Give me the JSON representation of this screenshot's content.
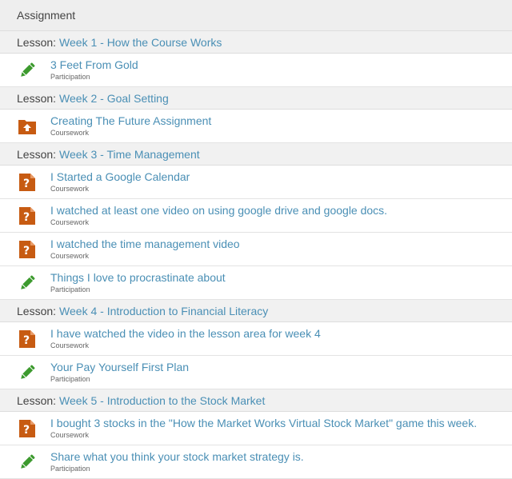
{
  "header": {
    "title": "Assignment"
  },
  "lesson_prefix": "Lesson:",
  "sections": [
    {
      "lesson": "Week 1 - How the Course Works",
      "items": [
        {
          "title": "3 Feet From Gold",
          "type": "Participation",
          "icon": "pencil-icon"
        }
      ]
    },
    {
      "lesson": "Week 2 - Goal Setting",
      "items": [
        {
          "title": "Creating The Future Assignment",
          "type": "Coursework",
          "icon": "folder-upload-icon"
        }
      ]
    },
    {
      "lesson": "Week 3 - Time Management",
      "items": [
        {
          "title": "I Started a Google Calendar",
          "type": "Coursework",
          "icon": "question-document-icon"
        },
        {
          "title": "I watched at least one video on using google drive and google docs.",
          "type": "Coursework",
          "icon": "question-document-icon"
        },
        {
          "title": "I watched the time management video",
          "type": "Coursework",
          "icon": "question-document-icon"
        },
        {
          "title": "Things I love to procrastinate about",
          "type": "Participation",
          "icon": "pencil-icon"
        }
      ]
    },
    {
      "lesson": "Week 4 - Introduction to Financial Literacy",
      "items": [
        {
          "title": "I have watched the video in the lesson area for week 4",
          "type": "Coursework",
          "icon": "question-document-icon"
        },
        {
          "title": "Your Pay Yourself First Plan",
          "type": "Participation",
          "icon": "pencil-icon"
        }
      ]
    },
    {
      "lesson": "Week 5 - Introduction to the Stock Market",
      "items": [
        {
          "title": "I bought 3 stocks in the \"How the Market Works Virtual Stock Market\" game this week.",
          "type": "Coursework",
          "icon": "question-document-icon"
        },
        {
          "title": "Share what you think your stock market strategy is.",
          "type": "Participation",
          "icon": "pencil-icon"
        }
      ]
    }
  ],
  "colors": {
    "link": "#4a8fb5",
    "pencil": "#3c9a2e",
    "orange": "#c75b12"
  }
}
